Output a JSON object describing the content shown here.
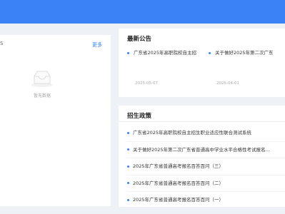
{
  "left_panel": {
    "edge_text": "S",
    "more_label": "更多",
    "empty_text": "暂无数据",
    "empty_icon": "empty-inbox-icon"
  },
  "notice": {
    "title": "最新公告",
    "items": [
      {
        "text": "广东省2025年高职院校自主招",
        "date": "2025-05-07"
      },
      {
        "text": "关于做好2025年第二次广东",
        "date": "2025-04-01"
      }
    ]
  },
  "policy": {
    "title": "招生政策",
    "items": [
      "广东省2025年高职院校自主招生职业适应性联合测试系统",
      "关于做好2025年第二次广东省普通高中学业水平合格性考试报名...",
      "2025年广东省普通高考报名百答百问（三）",
      "2025年广东省普通高考报名百答百问（二）",
      "2025年广东省普通高考报名百答百问（一）"
    ]
  },
  "colors": {
    "accent": "#3b82f6",
    "background": "#eef1f5"
  }
}
